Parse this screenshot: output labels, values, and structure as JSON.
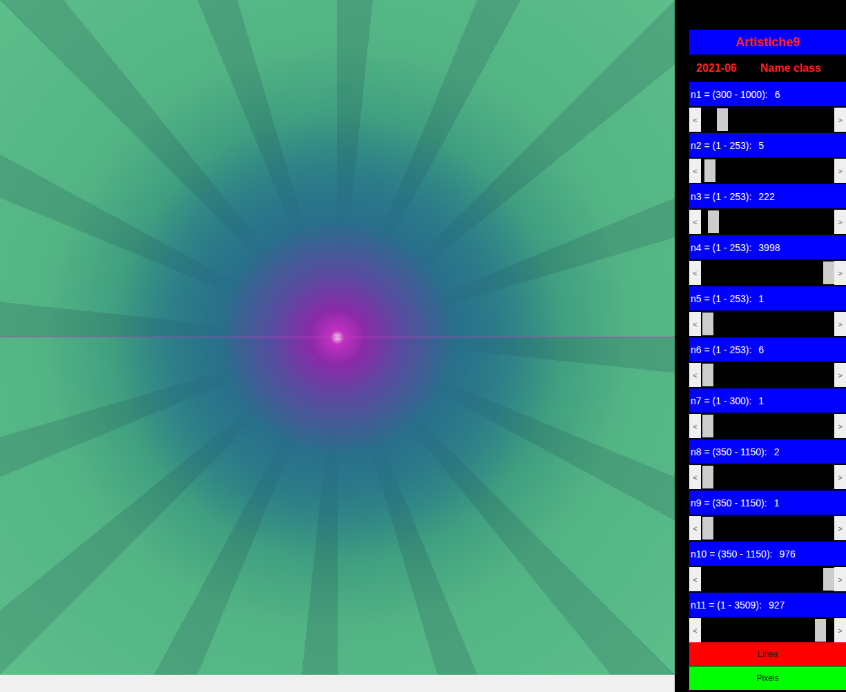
{
  "window": {
    "title": "Artistiche9"
  },
  "header": {
    "date": "2021-06",
    "label": "Name class"
  },
  "canvas": {
    "kind": "fractal"
  },
  "scrollbar": {
    "left": "<",
    "right": ">"
  },
  "sliders": [
    {
      "label": "n1 = (300 - 1000):",
      "value": "6",
      "level": 0.13
    },
    {
      "label": "n2 = (1 - 253):",
      "value": "5",
      "level": 0.03
    },
    {
      "label": "n3 = (1 - 253):",
      "value": "222",
      "level": 0.055
    },
    {
      "label": "n4 = (1 - 253):",
      "value": "3998",
      "level": 1.0
    },
    {
      "label": "n5 = (1 - 253):",
      "value": "1",
      "level": 0.01
    },
    {
      "label": "n6 = (1 - 253):",
      "value": "6",
      "level": 0.01
    },
    {
      "label": "n7 = (1 - 300):",
      "value": "1",
      "level": 0.01
    },
    {
      "label": "n8 = (350 - 1150):",
      "value": "2",
      "level": 0.01
    },
    {
      "label": "n9 = (350 - 1150):",
      "value": "1",
      "level": 0.01
    },
    {
      "label": "n10 = (350 - 1150):",
      "value": "976",
      "level": 1.0
    },
    {
      "label": "n11 = (1 - 3509):",
      "value": "927",
      "level": 0.93
    }
  ],
  "buttons": [
    {
      "label": "Linea",
      "color": "#ff0000"
    },
    {
      "label": "Pixels",
      "color": "#00ff00"
    }
  ]
}
